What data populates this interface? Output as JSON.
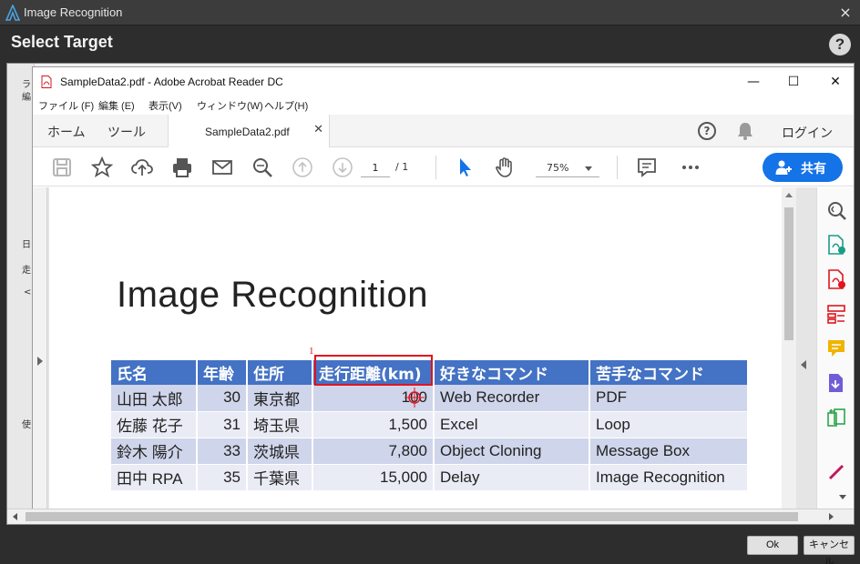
{
  "dialog": {
    "title": "Image Recognition",
    "heading": "Select Target",
    "help_label": "?",
    "close_label": "×",
    "ok_label": "Ok",
    "cancel_label": "キャンセル"
  },
  "background_window": {
    "fragments": [
      "ラ",
      "編",
      "日",
      "走",
      "<<",
      "使"
    ]
  },
  "acrobat": {
    "window_title": "SampleData2.pdf - Adobe Acrobat Reader DC",
    "menu": [
      "ファイル (F)",
      "編集 (E)",
      "表示(V)",
      "ウィンドウ(W)",
      "ヘルプ(H)"
    ],
    "tabs": {
      "home": "ホーム",
      "tools": "ツール",
      "document": "SampleData2.pdf",
      "login": "ログイン"
    },
    "toolbar": {
      "page_current": "1",
      "page_total": "/ 1",
      "zoom": "75%",
      "share_label": "共有"
    }
  },
  "document": {
    "title": "Image Recognition",
    "table": {
      "headers": [
        "氏名",
        "年齢",
        "住所",
        "走行距離(km)",
        "好きなコマンド",
        "苦手なコマンド"
      ],
      "rows": [
        [
          "山田 太郎",
          "30",
          "東京都",
          "100",
          "Web Recorder",
          "PDF"
        ],
        [
          "佐藤 花子",
          "31",
          "埼玉県",
          "1,500",
          "Excel",
          "Loop"
        ],
        [
          "鈴木 陽介",
          "33",
          "茨城県",
          "7,800",
          "Object Cloning",
          "Message Box"
        ],
        [
          "田中 RPA",
          "35",
          "千葉県",
          "15,000",
          "Delay",
          "Image Recognition"
        ]
      ]
    },
    "selection_index": "1"
  },
  "colors": {
    "table_header": "#4472c4",
    "row_dark": "#cfd5ea",
    "row_light": "#e9ebf5",
    "selection": "#e0141e",
    "share_button": "#1473e6"
  }
}
